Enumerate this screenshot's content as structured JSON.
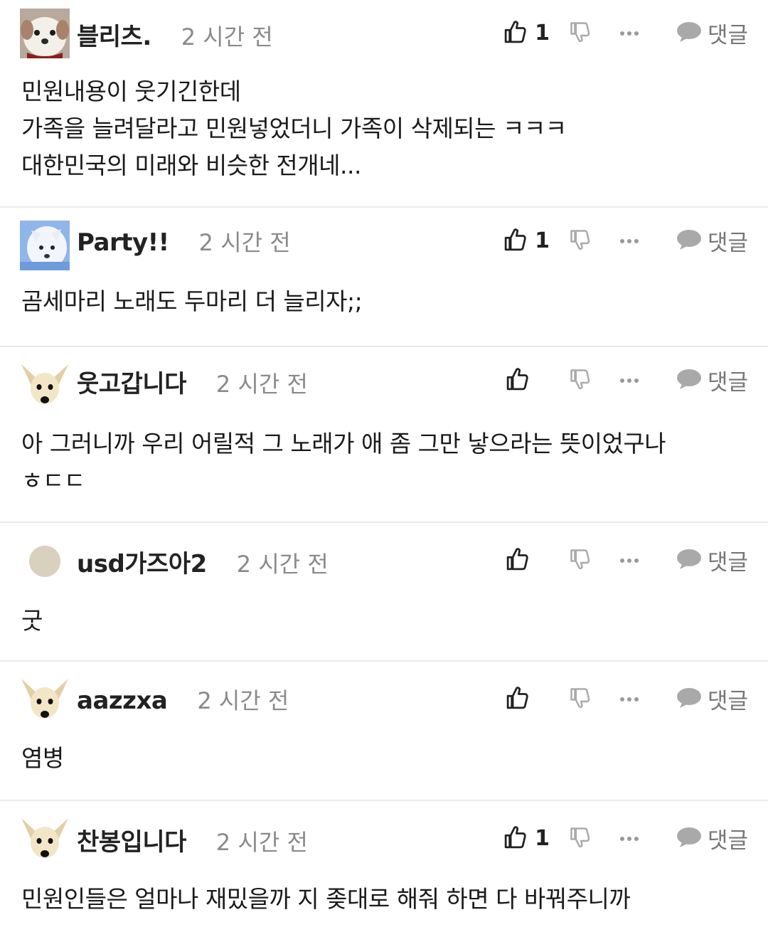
{
  "labels": {
    "reply": "댓글"
  },
  "icons": [
    "thumbs-up-icon",
    "thumbs-down-icon",
    "more-icon",
    "speech-bubble-icon"
  ],
  "comments": [
    {
      "username": "블리츠.",
      "time": "2 시간 전",
      "likes": "1",
      "avatar": "puppy",
      "text": "민원내용이 웃기긴한데\n가족을 늘려달라고 민원넣었더니 가족이 삭제되는 ㅋㅋㅋ\n대한민국의 미래와 비슷한 전개네..."
    },
    {
      "username": "Party!!",
      "time": "2 시간 전",
      "likes": "1",
      "avatar": "white-dog",
      "text": "곰세마리 노래도 두마리 더 늘리자;;"
    },
    {
      "username": "웃고갑니다",
      "time": "2 시간 전",
      "likes": "",
      "avatar": "chihuahua",
      "text": "아 그러니까 우리 어릴적 그 노래가 애 좀 그만 낳으라는 뜻이었구나\nㅎㄷㄷ"
    },
    {
      "username": "usd가즈아2",
      "time": "2 시간 전",
      "likes": "",
      "avatar": "circle",
      "text": "굿"
    },
    {
      "username": "aazzxa",
      "time": "2 시간 전",
      "likes": "",
      "avatar": "chihuahua",
      "text": "염병"
    },
    {
      "username": "찬봉입니다",
      "time": "2 시간 전",
      "likes": "1",
      "avatar": "chihuahua",
      "text": "민원인들은 얼마나 재밌을까 지 좆대로 해줘 하면 다 바꿔주니까"
    }
  ]
}
